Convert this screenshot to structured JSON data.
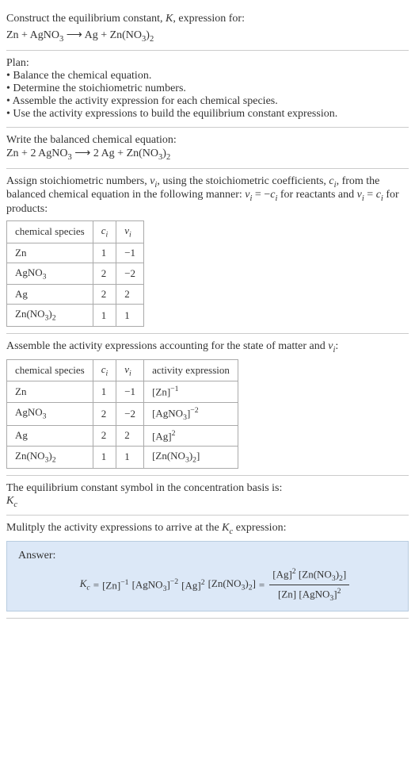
{
  "construct": {
    "title_prefix": "Construct the equilibrium constant, ",
    "title_k": "K",
    "title_suffix": ", expression for:",
    "equation_lhs1": "Zn + AgNO",
    "equation_sub1": "3",
    "equation_arrow": " ⟶ ",
    "equation_rhs1": "Ag + Zn(NO",
    "equation_sub2": "3",
    "equation_rhs2": ")",
    "equation_sub3": "2"
  },
  "plan": {
    "title": "Plan:",
    "items": [
      "• Balance the chemical equation.",
      "• Determine the stoichiometric numbers.",
      "• Assemble the activity expression for each chemical species.",
      "• Use the activity expressions to build the equilibrium constant expression."
    ]
  },
  "balanced": {
    "title": "Write the balanced chemical equation:",
    "eq_p1": "Zn + 2 AgNO",
    "eq_s1": "3",
    "eq_arrow": " ⟶ ",
    "eq_p2": "2 Ag + Zn(NO",
    "eq_s2": "3",
    "eq_p3": ")",
    "eq_s3": "2"
  },
  "stoich": {
    "intro_p1": "Assign stoichiometric numbers, ",
    "intro_nu": "ν",
    "intro_i": "i",
    "intro_p2": ", using the stoichiometric coefficients, ",
    "intro_c": "c",
    "intro_p3": ", from the balanced chemical equation in the following manner: ",
    "intro_eq1a": "ν",
    "intro_eq1b": " = −",
    "intro_eq1c": "c",
    "intro_p4": " for reactants and ",
    "intro_eq2a": "ν",
    "intro_eq2b": " = ",
    "intro_eq2c": "c",
    "intro_p5": " for products:",
    "headers": {
      "species": "chemical species",
      "c": "c",
      "c_sub": "i",
      "nu": "ν",
      "nu_sub": "i"
    },
    "rows": [
      {
        "species_p1": "Zn",
        "species_s1": "",
        "c": "1",
        "nu": "−1"
      },
      {
        "species_p1": "AgNO",
        "species_s1": "3",
        "c": "2",
        "nu": "−2"
      },
      {
        "species_p1": "Ag",
        "species_s1": "",
        "c": "2",
        "nu": "2"
      },
      {
        "species_p1": "Zn(NO",
        "species_s1": "3",
        "species_p2": ")",
        "species_s2": "2",
        "c": "1",
        "nu": "1"
      }
    ]
  },
  "activity": {
    "intro_p1": "Assemble the activity expressions accounting for the state of matter and ",
    "intro_nu": "ν",
    "intro_i": "i",
    "intro_p2": ":",
    "headers": {
      "species": "chemical species",
      "c": "c",
      "c_sub": "i",
      "nu": "ν",
      "nu_sub": "i",
      "act": "activity expression"
    },
    "rows": [
      {
        "species_p1": "Zn",
        "c": "1",
        "nu": "−1",
        "act_base": "[Zn]",
        "act_sup": "−1"
      },
      {
        "species_p1": "AgNO",
        "species_s1": "3",
        "c": "2",
        "nu": "−2",
        "act_base_p1": "[AgNO",
        "act_base_s1": "3",
        "act_base_p2": "]",
        "act_sup": "−2"
      },
      {
        "species_p1": "Ag",
        "c": "2",
        "nu": "2",
        "act_base": "[Ag]",
        "act_sup": "2"
      },
      {
        "species_p1": "Zn(NO",
        "species_s1": "3",
        "species_p2": ")",
        "species_s2": "2",
        "c": "1",
        "nu": "1",
        "act_base_p1": "[Zn(NO",
        "act_base_s1": "3",
        "act_base_p2": ")",
        "act_base_s2": "2",
        "act_base_p3": "]",
        "act_sup": ""
      }
    ]
  },
  "symbol": {
    "line1": "The equilibrium constant symbol in the concentration basis is:",
    "kc_k": "K",
    "kc_c": "c"
  },
  "multiply": {
    "intro_p1": "Mulitply the activity expressions to arrive at the ",
    "kc_k": "K",
    "kc_c": "c",
    "intro_p2": " expression:"
  },
  "answer": {
    "label": "Answer:",
    "kc_k": "K",
    "kc_c": "c",
    "eq": " = ",
    "t1": "[Zn]",
    "t1_sup": "−1",
    "sp": " ",
    "t2_p1": "[AgNO",
    "t2_s1": "3",
    "t2_p2": "]",
    "t2_sup": "−2",
    "t3": "[Ag]",
    "t3_sup": "2",
    "t4_p1": "[Zn(NO",
    "t4_s1": "3",
    "t4_p2": ")",
    "t4_s2": "2",
    "t4_p3": "]",
    "eq2": " = ",
    "num_t1": "[Ag]",
    "num_t1_sup": "2",
    "num_t2_p1": "[Zn(NO",
    "num_t2_s1": "3",
    "num_t2_p2": ")",
    "num_t2_s2": "2",
    "num_t2_p3": "]",
    "den_t1": "[Zn] ",
    "den_t2_p1": "[AgNO",
    "den_t2_s1": "3",
    "den_t2_p2": "]",
    "den_t2_sup": "2"
  }
}
